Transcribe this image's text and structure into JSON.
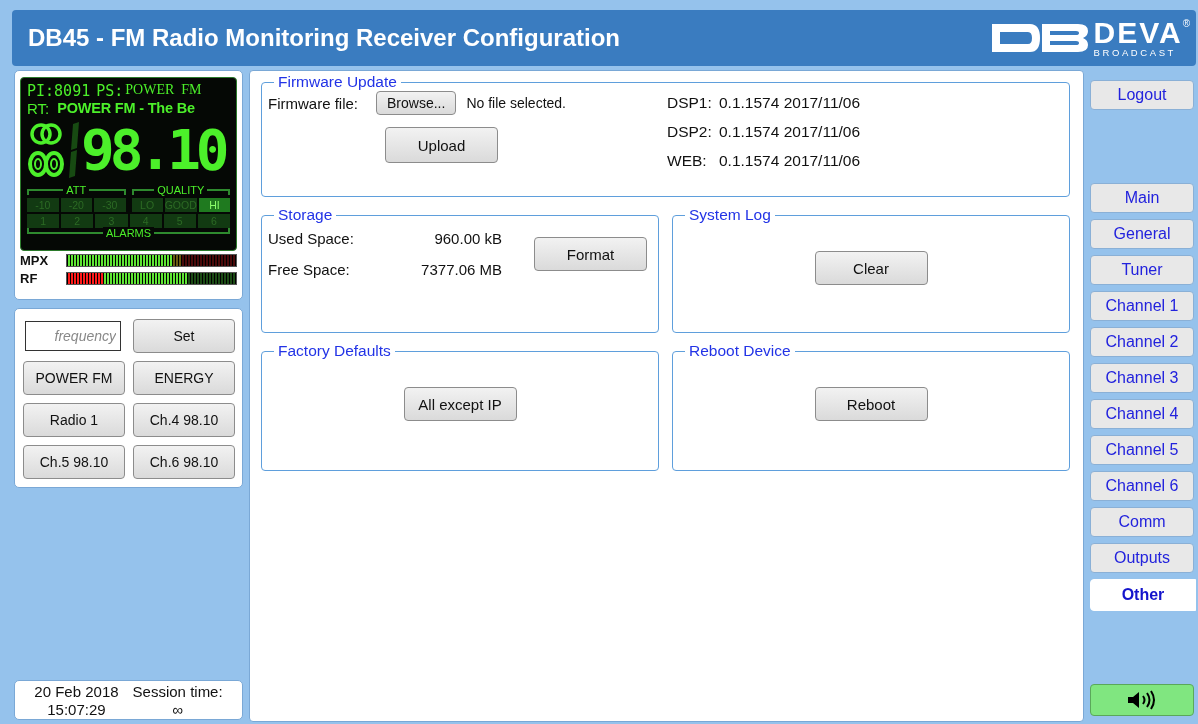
{
  "header": {
    "title": "DB45 - FM Radio Monitoring Receiver Configuration",
    "logo": {
      "wordmark": "DEVA",
      "registered": "®",
      "tagline": "BROADCAST"
    }
  },
  "lcd": {
    "pi_label": "PI:",
    "pi": "8091",
    "ps_label": "PS:",
    "ps": "POWER  FM",
    "rt_label": "RT:",
    "rt": "POWER FM - The Be",
    "stereo": true,
    "rds": true,
    "frequency": "98.10",
    "att_title": "ATT",
    "quality_title": "QUALITY",
    "alarms_title": "ALARMS",
    "att": [
      {
        "label": "-10",
        "on": false
      },
      {
        "label": "-20",
        "on": false
      },
      {
        "label": "-30",
        "on": false
      }
    ],
    "quality": [
      {
        "label": "LO",
        "on": false
      },
      {
        "label": "GOOD",
        "on": false
      },
      {
        "label": "HI",
        "on": true
      }
    ],
    "alarms": [
      {
        "label": "1",
        "on": false
      },
      {
        "label": "2",
        "on": false
      },
      {
        "label": "3",
        "on": false
      },
      {
        "label": "4",
        "on": false
      },
      {
        "label": "5",
        "on": false
      },
      {
        "label": "6",
        "on": false
      }
    ]
  },
  "meters": [
    {
      "label": "MPX",
      "kind": "mpx",
      "level": 0.62
    },
    {
      "label": "RF",
      "kind": "rf",
      "level": 0.72
    }
  ],
  "tuner": {
    "frequency_field": {
      "placeholder": "frequency"
    },
    "set_button": "Set",
    "presets": [
      "POWER FM",
      "ENERGY",
      "Radio 1",
      "Ch.4 98.10",
      "Ch.5 98.10",
      "Ch.6 98.10"
    ]
  },
  "status": {
    "date": "20 Feb 2018",
    "time": "15:07:29",
    "session_label": "Session time:",
    "session": "∞"
  },
  "firmware": {
    "title": "Firmware Update",
    "file_label": "Firmware file:",
    "browse_button": "Browse...",
    "file_status": "No file selected.",
    "upload_button": "Upload",
    "versions": [
      {
        "label": "DSP1:",
        "value": "0.1.1574 2017/11/06"
      },
      {
        "label": "DSP2:",
        "value": "0.1.1574 2017/11/06"
      },
      {
        "label": "WEB:",
        "value": "0.1.1574 2017/11/06"
      }
    ]
  },
  "storage": {
    "title": "Storage",
    "rows": [
      {
        "label": "Used Space:",
        "value": "960.00 kB"
      },
      {
        "label": "Free Space:",
        "value": "7377.06 MB"
      }
    ],
    "button": "Format"
  },
  "system_log": {
    "title": "System Log",
    "button": "Clear"
  },
  "factory_defaults": {
    "title": "Factory Defaults",
    "button": "All except IP"
  },
  "reboot_device": {
    "title": "Reboot Device",
    "button": "Reboot"
  },
  "nav": {
    "logout": "Logout",
    "items": [
      {
        "label": "Main",
        "selected": false
      },
      {
        "label": "General",
        "selected": false
      },
      {
        "label": "Tuner",
        "selected": false
      },
      {
        "label": "Channel 1",
        "selected": false
      },
      {
        "label": "Channel 2",
        "selected": false
      },
      {
        "label": "Channel 3",
        "selected": false
      },
      {
        "label": "Channel 4",
        "selected": false
      },
      {
        "label": "Channel 5",
        "selected": false
      },
      {
        "label": "Channel 6",
        "selected": false
      },
      {
        "label": "Comm",
        "selected": false
      },
      {
        "label": "Outputs",
        "selected": false
      },
      {
        "label": "Other",
        "selected": true
      }
    ],
    "sound_on": true
  }
}
